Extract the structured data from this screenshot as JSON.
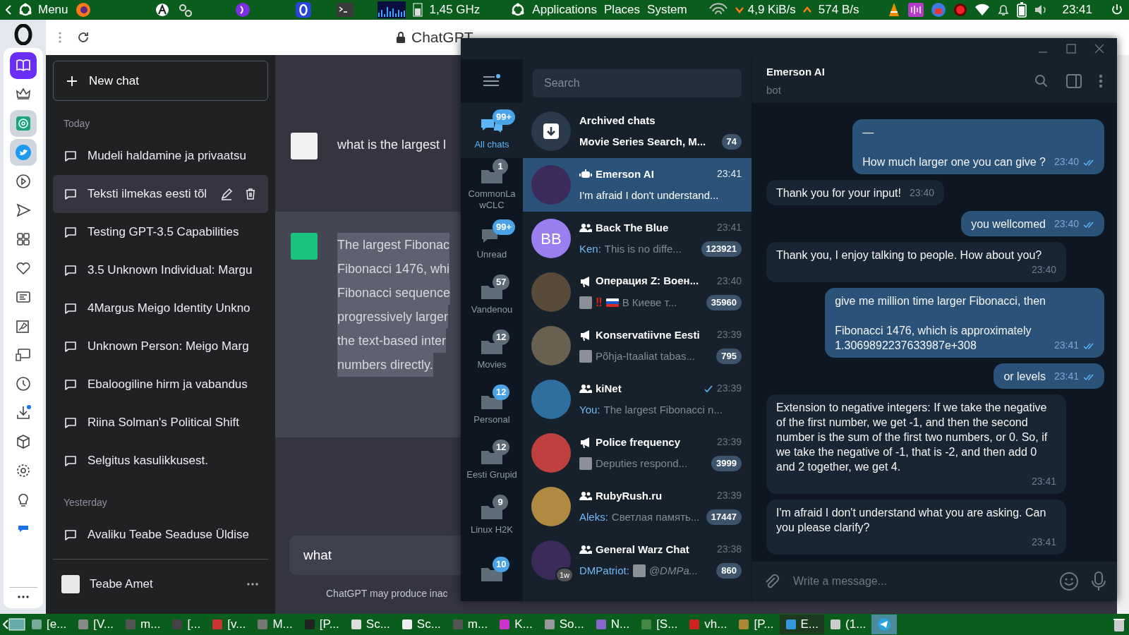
{
  "top_panel": {
    "menu": "Menu",
    "cpu": "1,45 GHz",
    "menus": [
      "Applications",
      "Places",
      "System"
    ],
    "net_down": "4,9 KiB/s",
    "net_up": "574 B/s",
    "clock": "23:41"
  },
  "browser": {
    "page_title": "ChatGPT"
  },
  "chatgpt": {
    "new_chat": "New chat",
    "sections": [
      {
        "heading": "Today",
        "items": [
          {
            "title": "Mudeli haldamine ja privaatsu",
            "selected": false
          },
          {
            "title": "Teksti ilmekas eesti tõl",
            "selected": true
          },
          {
            "title": "Testing GPT-3.5 Capabilities",
            "selected": false
          },
          {
            "title": "3.5 Unknown Individual: Margu",
            "selected": false
          },
          {
            "title": "4Margus Meigo Identity Unkno",
            "selected": false
          },
          {
            "title": "Unknown Person: Meigo Marg",
            "selected": false
          },
          {
            "title": "Ebaloogiline hirm ja vabandus",
            "selected": false
          },
          {
            "title": "Riina Solman's Political Shift",
            "selected": false
          },
          {
            "title": "Selgitus kasulikkusest.",
            "selected": false
          }
        ]
      },
      {
        "heading": "Yesterday",
        "items": [
          {
            "title": "Avaliku Teabe Seaduse Üldise",
            "selected": false
          }
        ]
      }
    ],
    "account": "Teabe Amet",
    "messages": [
      {
        "kind": "user",
        "lines": [
          "what is the largest l"
        ]
      },
      {
        "kind": "assistant",
        "lines": [
          "The largest Fibonac",
          "Fibonacci 1476, whi",
          "Fibonacci sequence",
          "progressively larger",
          "the text-based inter",
          "numbers directly."
        ]
      }
    ],
    "input": "what",
    "disclaimer": "ChatGPT may produce inac"
  },
  "telegram": {
    "search_placeholder": "Search",
    "folders": [
      {
        "label": "All chats",
        "badge": "99+",
        "badge_muted": false,
        "selected": true
      },
      {
        "label": "CommonLawCLC",
        "badge": "1",
        "badge_muted": true,
        "selected": false
      },
      {
        "label": "Unread",
        "badge": "99+",
        "badge_muted": false,
        "selected": false
      },
      {
        "label": "Vandenou",
        "badge": "57",
        "badge_muted": true,
        "selected": false
      },
      {
        "label": "Movies",
        "badge": "12",
        "badge_muted": true,
        "selected": false
      },
      {
        "label": "Personal",
        "badge": "12",
        "badge_muted": false,
        "selected": false
      },
      {
        "label": "Eesti Grupid",
        "badge": "12",
        "badge_muted": true,
        "selected": false
      },
      {
        "label": "Linux H2K",
        "badge": "9",
        "badge_muted": true,
        "selected": false
      },
      {
        "badge": "10",
        "badge_muted": false,
        "selected": false
      }
    ],
    "archive": {
      "title": "Archived chats",
      "preview": "Movie Series Search, M...",
      "badge": "74"
    },
    "chats": [
      {
        "kind": "bot",
        "name": "Emerson AI",
        "time": "23:41",
        "preview": "I'm afraid I don't understand...",
        "selected": true,
        "sent": false
      },
      {
        "kind": "group",
        "name": "Back The Blue",
        "time": "23:41",
        "initials": "BB",
        "color": "#9b7ef0",
        "sender": "Ken:",
        "preview": "This is no diffe...",
        "badge": "123921",
        "selected": false,
        "sent": false
      },
      {
        "kind": "channel",
        "name": "Операция Z: Воен...",
        "time": "23:40",
        "media": true,
        "alert": "‼",
        "flag": true,
        "preview": "В Киеве т...",
        "badge": "35960",
        "selected": false,
        "sent": false
      },
      {
        "kind": "channel",
        "name": "Konservatiivne Eesti",
        "time": "23:39",
        "media": true,
        "preview": "Põhja-Itaaliat tabas...",
        "badge": "795",
        "selected": false,
        "sent": false
      },
      {
        "kind": "group",
        "name": "kiNet",
        "time": "23:39",
        "sender": "You:",
        "preview": "The largest Fibonacci n...",
        "selected": false,
        "sent": true
      },
      {
        "kind": "channel",
        "name": "Police frequency",
        "time": "23:39",
        "media": true,
        "preview": "Deputies respond...",
        "badge": "3999",
        "selected": false,
        "sent": false
      },
      {
        "kind": "group",
        "name": "RubyRush.ru",
        "time": "23:39",
        "sender": "Aleks:",
        "preview": "Светлая память...",
        "badge": "17447",
        "selected": false,
        "sent": false
      },
      {
        "kind": "group",
        "name": "General Warz Chat",
        "time": "23:38",
        "avatar_tag": "1w",
        "sender": "DMPatriot:",
        "media": true,
        "preview": "@DMPa...",
        "preview_italic": true,
        "badge": "860",
        "selected": false,
        "sent": false
      }
    ],
    "header": {
      "title": "Emerson AI",
      "subtitle": "bot"
    },
    "messages": [
      {
        "out": true,
        "text": "—\n\nHow much larger one you can give ?",
        "time": "23:40",
        "read": true
      },
      {
        "out": false,
        "text": "Thank you for your input!",
        "time": "23:40"
      },
      {
        "out": true,
        "text": "you wellcomed",
        "time": "23:40",
        "read": true
      },
      {
        "out": false,
        "text": "Thank you, I enjoy talking to people. How about you?",
        "time": "23:40"
      },
      {
        "out": true,
        "text": "give me million time larger Fibonacci, then\n\nFibonacci 1476, which is approximately\n1.3069892237633987e+308",
        "time": "23:41",
        "read": true
      },
      {
        "out": true,
        "text": "or levels",
        "time": "23:41",
        "read": true
      },
      {
        "out": false,
        "text": "Extension to negative integers: If we take the negative of the first number, we get -1, and then the second number is the sum of the first two numbers, or 0. So, if we take the negative of -1, that is -2, and then add 0 and 2 together, we get 4.",
        "time": "23:41"
      },
      {
        "out": false,
        "text": "I'm afraid I don't understand what you are asking. Can you please clarify?",
        "time": "23:41"
      }
    ],
    "composer_placeholder": "Write a message..."
  },
  "taskbar": [
    "[e...",
    "[V...",
    "m...",
    "[...",
    "[v...",
    "M...",
    "[P...",
    "Sc...",
    "Sc...",
    "m...",
    "K...",
    "So...",
    "N...",
    "[S...",
    "vh...",
    "[P...",
    "E...",
    "(1..."
  ]
}
